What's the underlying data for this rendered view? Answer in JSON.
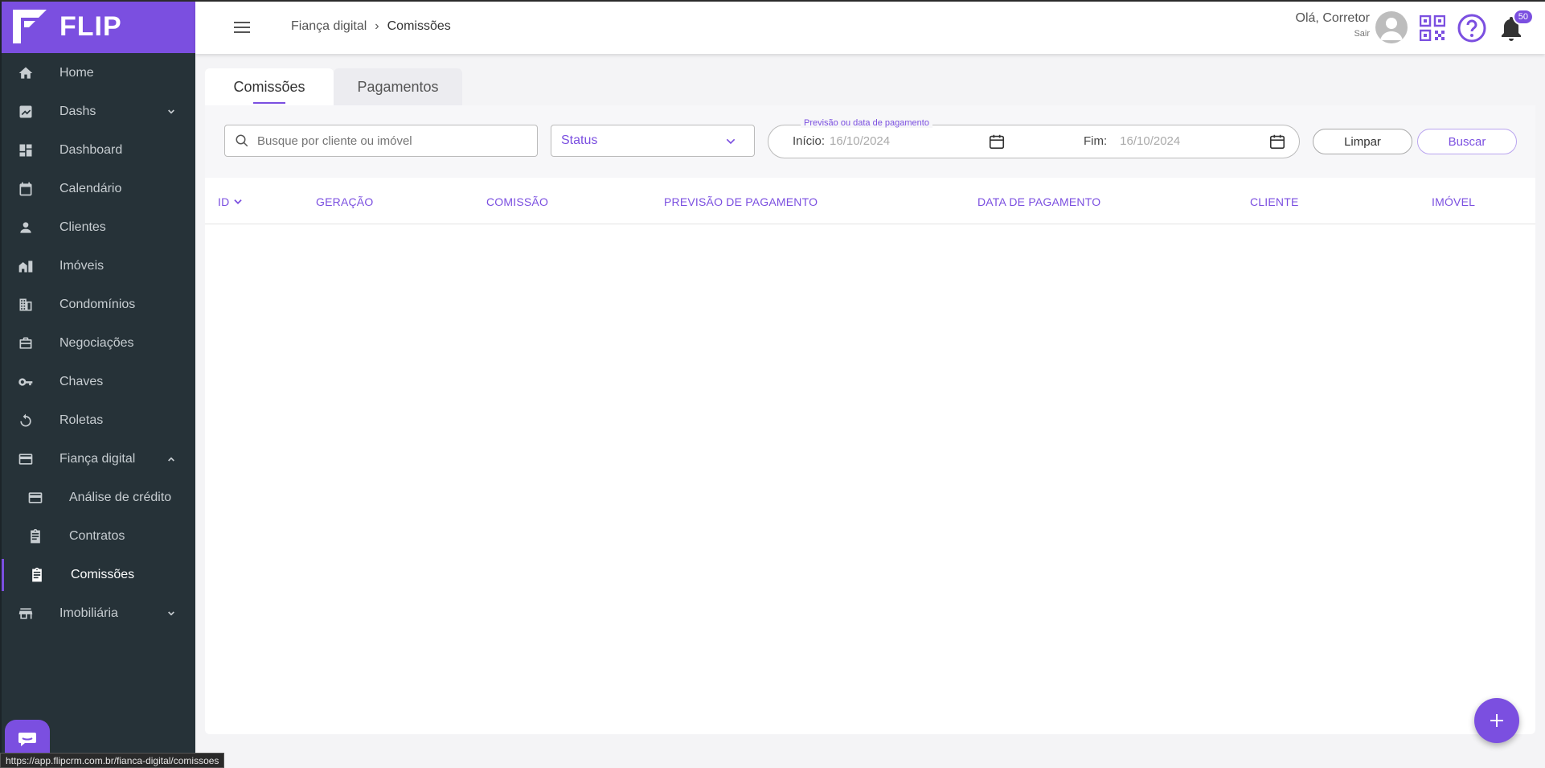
{
  "logo": {
    "text": "FLIP"
  },
  "sidebar": {
    "items": [
      {
        "label": "Home",
        "icon": "home-icon"
      },
      {
        "label": "Dashs",
        "icon": "chart-icon"
      },
      {
        "label": "Dashboard",
        "icon": "dashboard-icon"
      },
      {
        "label": "Calendário",
        "icon": "calendar-icon"
      },
      {
        "label": "Clientes",
        "icon": "person-icon"
      },
      {
        "label": "Imóveis",
        "icon": "building-icon"
      },
      {
        "label": "Condomínios",
        "icon": "apartment-icon"
      },
      {
        "label": "Negociações",
        "icon": "briefcase-icon"
      },
      {
        "label": "Chaves",
        "icon": "key-icon"
      },
      {
        "label": "Roletas",
        "icon": "rotate-icon"
      },
      {
        "label": "Fiança digital",
        "icon": "card-icon"
      },
      {
        "label": "Análise de crédito",
        "icon": "card-icon"
      },
      {
        "label": "Contratos",
        "icon": "clipboard-icon"
      },
      {
        "label": "Comissões",
        "icon": "clipboard-icon"
      },
      {
        "label": "Imobiliária",
        "icon": "store-icon"
      }
    ]
  },
  "header": {
    "breadcrumb_parent": "Fiança digital",
    "breadcrumb_sep": "›",
    "breadcrumb_current": "Comissões",
    "greeting": "Olá, Corretor",
    "logout": "Sair",
    "notifications": "50"
  },
  "tabs": {
    "comissoes": "Comissões",
    "pagamentos": "Pagamentos"
  },
  "filters": {
    "search_placeholder": "Busque por cliente ou imóvel",
    "status_label": "Status",
    "date_legend": "Previsão ou data de pagamento",
    "start_label": "Início:",
    "start_value": "16/10/2024",
    "end_label": "Fim:",
    "end_value": "16/10/2024",
    "clear_label": "Limpar",
    "search_label": "Buscar"
  },
  "table": {
    "columns": [
      "ID",
      "GERAÇÃO",
      "COMISSÃO",
      "PREVISÃO DE PAGAMENTO",
      "DATA DE PAGAMENTO",
      "CLIENTE",
      "IMÓVEL"
    ]
  },
  "status_bar": {
    "url": "https://app.flipcrm.com.br/fianca-digital/comissoes"
  },
  "colors": {
    "accent": "#7b4fe0",
    "sidebar": "#263238"
  }
}
